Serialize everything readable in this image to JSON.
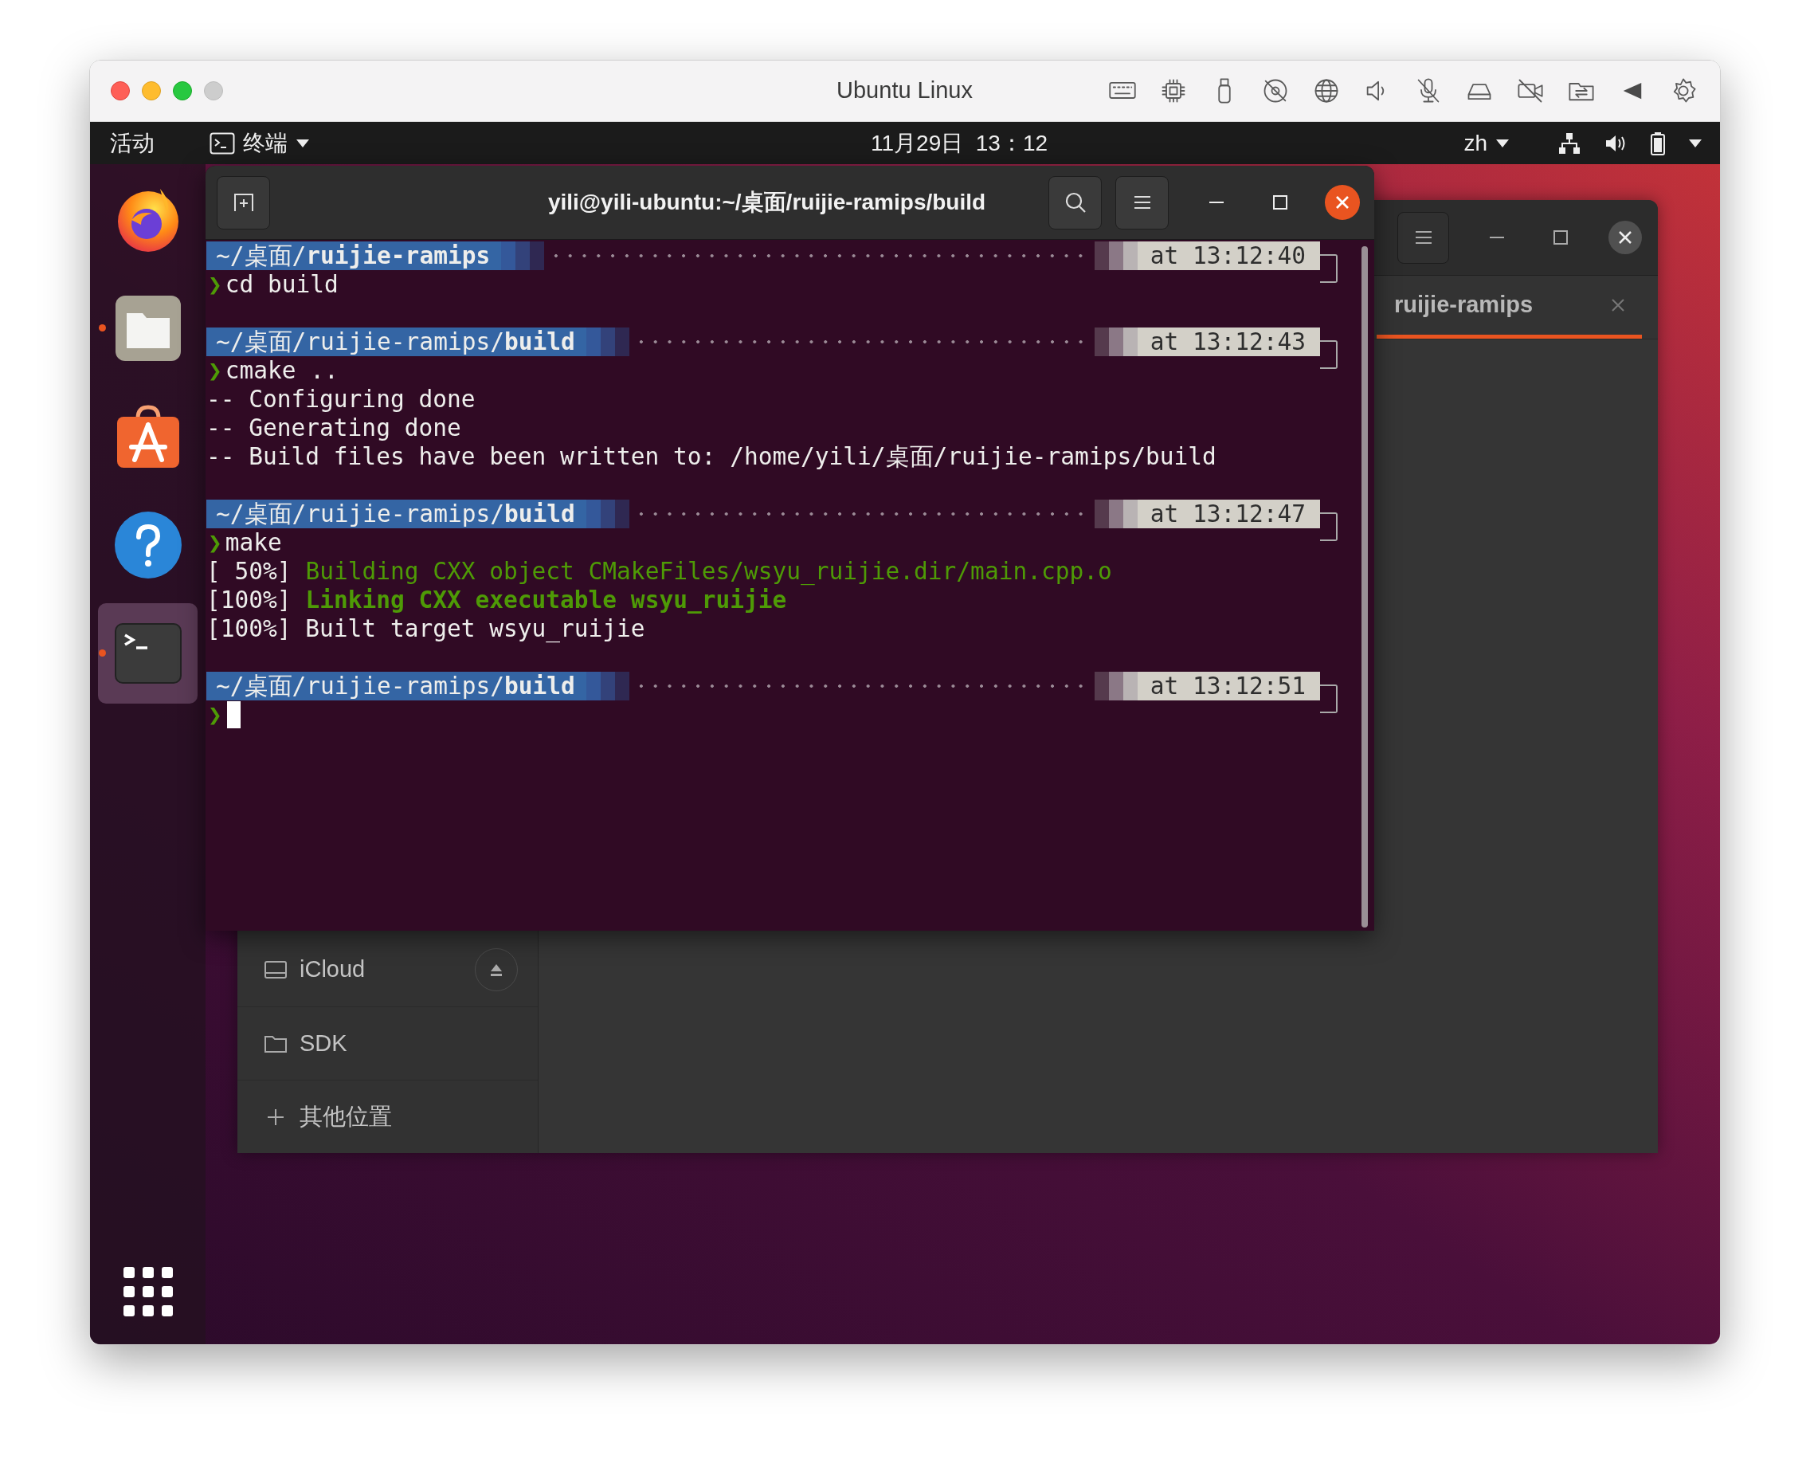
{
  "mac_window": {
    "title": "Ubuntu Linux"
  },
  "top_panel": {
    "activities": "活动",
    "app_menu": "终端",
    "clock": "11月29日  13：12",
    "input_method": "zh"
  },
  "dock": {
    "items": [
      {
        "kind": "firefox",
        "running": false,
        "selected": false
      },
      {
        "kind": "files",
        "running": true,
        "selected": false
      },
      {
        "kind": "software",
        "running": false,
        "selected": false
      },
      {
        "kind": "help",
        "running": false,
        "selected": false
      },
      {
        "kind": "terminal",
        "running": true,
        "selected": true
      }
    ]
  },
  "file_manager": {
    "tab": {
      "label": "ruijie-ramips",
      "selected": true
    },
    "sidebar": [
      {
        "kind": "drive",
        "label": "iCloud",
        "ejectable": true
      },
      {
        "kind": "folder",
        "label": "SDK",
        "ejectable": false
      },
      {
        "kind": "add",
        "label": "其他位置",
        "ejectable": false
      }
    ]
  },
  "terminal": {
    "title": "yili@yili-ubuntu:~/桌面/ruijie-ramips/build",
    "lines": [
      {
        "kind": "prompt",
        "path": "~/桌面/**ruijie-ramips**",
        "time": "at 13:12:40"
      },
      {
        "kind": "command",
        "symbol": "❯",
        "text": "cd build",
        "cursor": false
      },
      {
        "kind": "blank"
      },
      {
        "kind": "prompt",
        "path": "~/桌面/ruijie-ramips/**build**",
        "time": "at 13:12:43"
      },
      {
        "kind": "command",
        "symbol": "❯",
        "text": "cmake ..",
        "cursor": false
      },
      {
        "kind": "output",
        "text": "-- Configuring done"
      },
      {
        "kind": "output",
        "text": "-- Generating done"
      },
      {
        "kind": "output",
        "text": "-- Build files have been written to: /home/yili/桌面/ruijie-ramips/build"
      },
      {
        "kind": "blank"
      },
      {
        "kind": "prompt",
        "path": "~/桌面/ruijie-ramips/**build**",
        "time": "at 13:12:47"
      },
      {
        "kind": "command",
        "symbol": "❯",
        "text": "make",
        "cursor": false
      },
      {
        "kind": "progress",
        "percent": "[ 50%]",
        "text": "Building CXX object CMakeFiles/wsyu_ruijie.dir/main.cpp.o",
        "bold": false
      },
      {
        "kind": "progress",
        "percent": "[100%]",
        "text": "Linking CXX executable wsyu_ruijie",
        "bold": true
      },
      {
        "kind": "output",
        "text": "[100%] Built target wsyu_ruijie"
      },
      {
        "kind": "blank"
      },
      {
        "kind": "prompt",
        "path": "~/桌面/ruijie-ramips/**build**",
        "time": "at 13:12:51"
      },
      {
        "kind": "command",
        "symbol": "❯",
        "cursor": true
      }
    ]
  }
}
